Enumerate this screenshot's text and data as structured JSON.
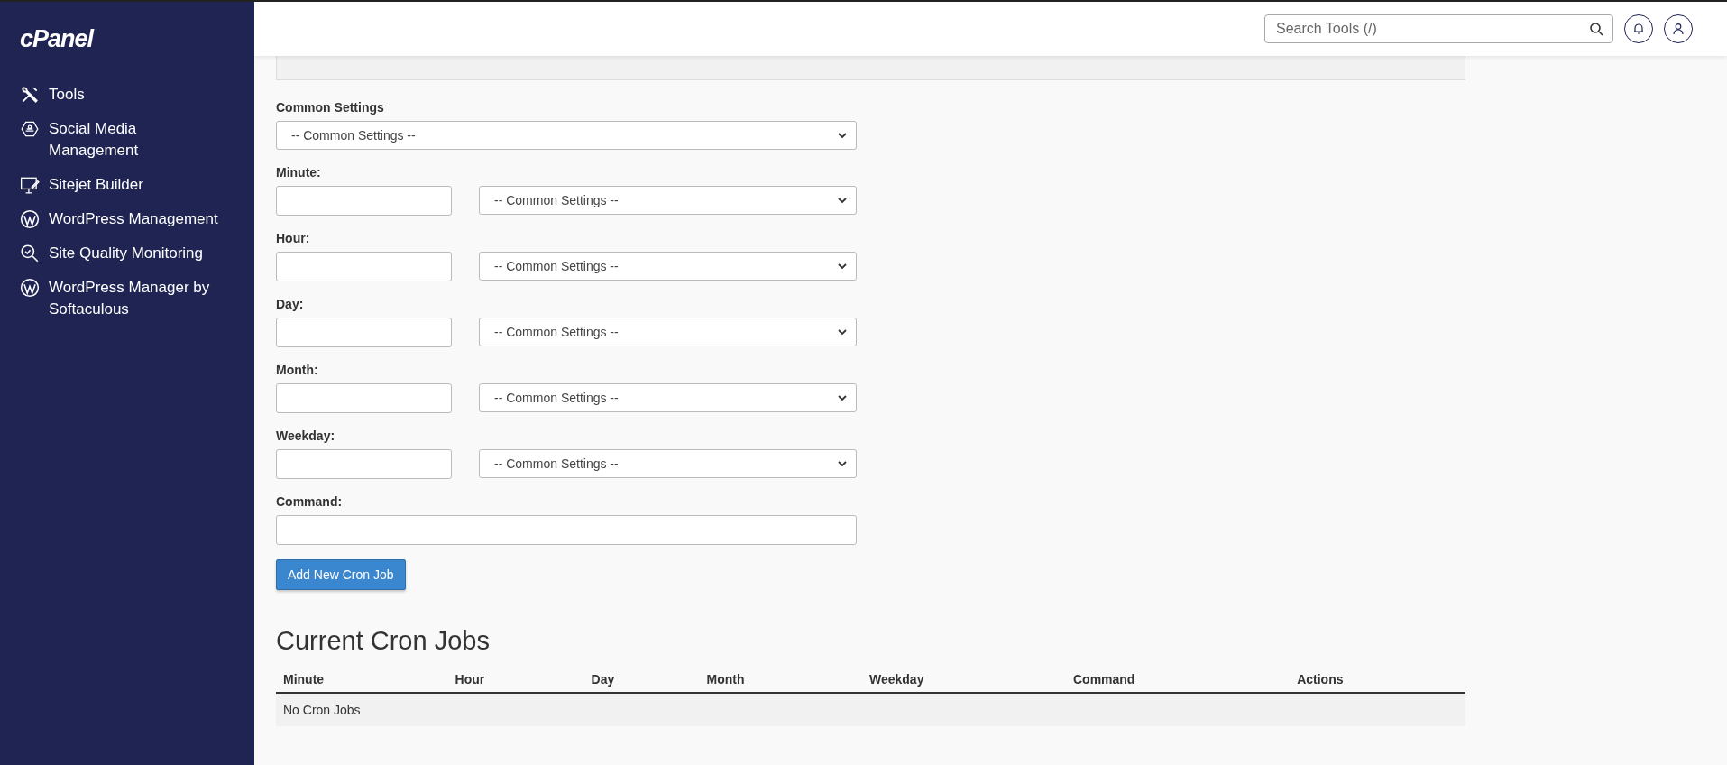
{
  "sidebar": {
    "logo": "cPanel",
    "items": [
      {
        "label": "Tools"
      },
      {
        "label": "Social Media Management"
      },
      {
        "label": "Sitejet Builder"
      },
      {
        "label": "WordPress Management"
      },
      {
        "label": "Site Quality Monitoring"
      },
      {
        "label": "WordPress Manager by Softaculous"
      }
    ]
  },
  "header": {
    "search": {
      "placeholder": "Search Tools (/)"
    }
  },
  "form": {
    "common": {
      "label": "Common Settings",
      "value": "-- Common Settings --"
    },
    "fields": [
      {
        "label": "Minute:",
        "select": "-- Common Settings --"
      },
      {
        "label": "Hour:",
        "select": "-- Common Settings --"
      },
      {
        "label": "Day:",
        "select": "-- Common Settings --"
      },
      {
        "label": "Month:",
        "select": "-- Common Settings --"
      },
      {
        "label": "Weekday:",
        "select": "-- Common Settings --"
      }
    ],
    "command": {
      "label": "Command:"
    },
    "submit": "Add New Cron Job"
  },
  "cron_jobs": {
    "title": "Current Cron Jobs",
    "columns": [
      "Minute",
      "Hour",
      "Day",
      "Month",
      "Weekday",
      "Command",
      "Actions"
    ],
    "empty": "No Cron Jobs"
  }
}
